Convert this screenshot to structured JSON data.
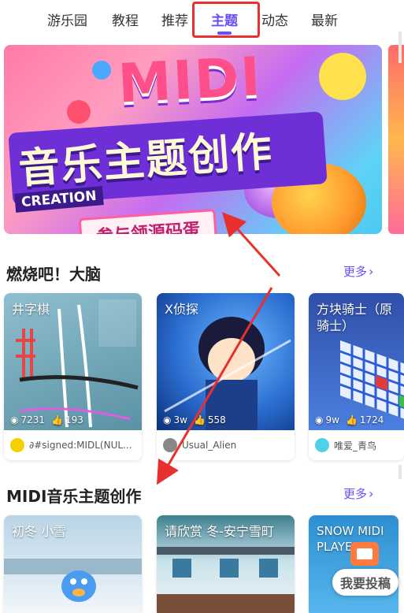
{
  "tabs": [
    {
      "label": "游乐园"
    },
    {
      "label": "教程"
    },
    {
      "label": "推荐"
    },
    {
      "label": "主题"
    },
    {
      "label": "动态"
    },
    {
      "label": "最新"
    }
  ],
  "active_tab": "主题",
  "banner": {
    "midi": "MIDI",
    "title": "音乐主题创作",
    "creation": "CREATION",
    "subtitle": "参与领源码蛋"
  },
  "section1": {
    "title": "燃烧吧！大脑",
    "more": "更多",
    "cards": [
      {
        "title": "井字棋",
        "views": "7231",
        "likes": "193",
        "author": "∂#signed:MIDL(NUL...",
        "avatar_color": "#f5d000"
      },
      {
        "title": "X侦探",
        "views": "3w",
        "likes": "558",
        "author": "Usual_Alien",
        "avatar_color": "#888888"
      },
      {
        "title": "方块骑士（原骑士）",
        "views": "9w",
        "likes": "1724",
        "author": "唯爱_青鸟",
        "avatar_color": "#4fd1e8"
      }
    ]
  },
  "section2": {
    "title": "MIDI音乐主题创作",
    "more": "更多",
    "cards": [
      {
        "title": "初冬 小雪"
      },
      {
        "title": "请欣赏 冬-安宁雪町"
      },
      {
        "title": "SNOW MIDI PLAYER"
      }
    ]
  },
  "post_button": "我要投稿",
  "colors": {
    "accent": "#6b4cf5",
    "highlight": "#e8302e"
  }
}
